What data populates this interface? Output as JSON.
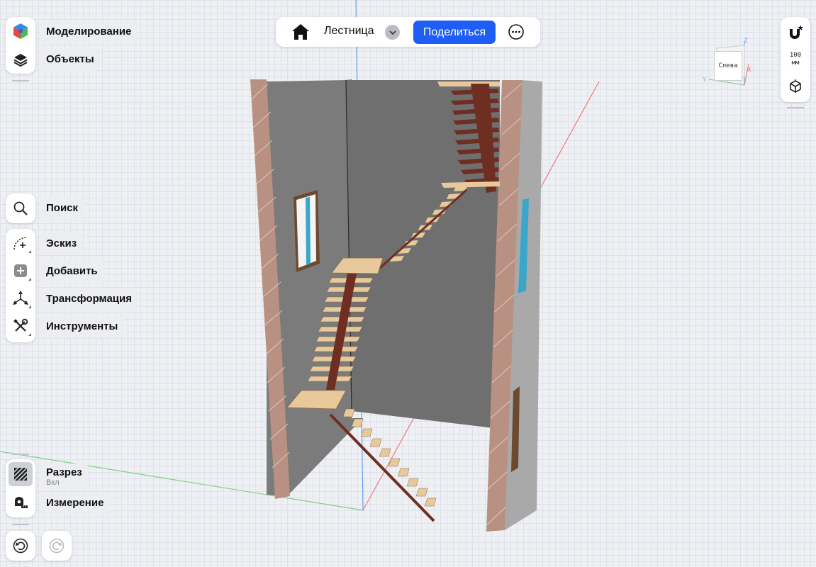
{
  "left_top": {
    "modeling_label": "Моделирование",
    "objects_label": "Объекты"
  },
  "left_mid": {
    "search_label": "Поиск",
    "sketch_label": "Эскиз",
    "add_label": "Добавить",
    "transform_label": "Трансформация",
    "tools_label": "Инструменты"
  },
  "left_bottom": {
    "section_label": "Разрез",
    "section_state": "Вкл",
    "measure_label": "Измерение"
  },
  "topbar": {
    "title": "Лестница",
    "share_label": "Поделиться"
  },
  "right": {
    "grid_value": "100",
    "grid_unit": "мм"
  },
  "viewcube": {
    "face_label": "Слева",
    "axis_z": "Z",
    "axis_y": "Y",
    "axis_x": "X"
  },
  "colors": {
    "accent": "#1e5ef6",
    "axis_red": "#f07a78",
    "axis_green": "#7fcf8a",
    "axis_blue": "#6aa0f0",
    "wall": "#7a7a7a",
    "brick": "#b89183",
    "tread": "#e8c99c",
    "stringer": "#6e2e22"
  }
}
